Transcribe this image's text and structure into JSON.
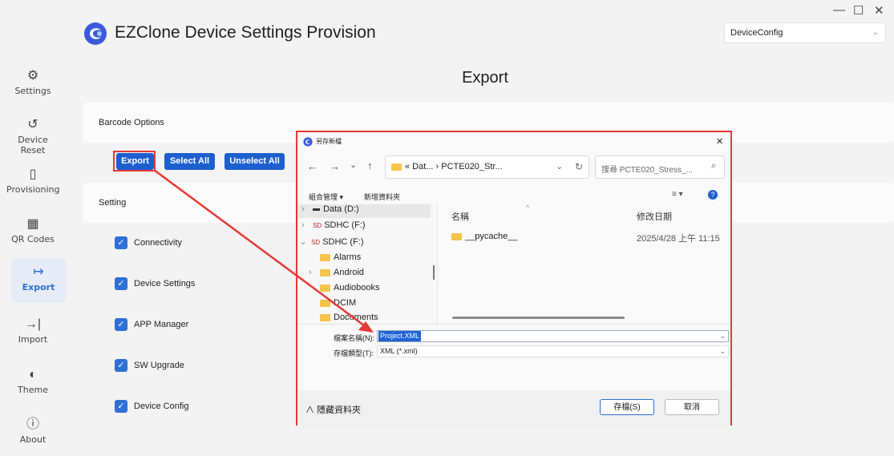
{
  "window": {
    "minimize": "—",
    "maximize": "☐",
    "close": "✕"
  },
  "header": {
    "title": "EZClone Device Settings Provision",
    "config_value": "DeviceConfig",
    "chevron": "⌄"
  },
  "sidebar": {
    "items": [
      {
        "label": "Settings",
        "icon": "⚙",
        "icon_name": "gear-icon"
      },
      {
        "label": "Device Reset",
        "icon": "↺",
        "icon_name": "reset-icon"
      },
      {
        "label": "Provisioning",
        "icon": "▯",
        "icon_name": "provisioning-icon"
      },
      {
        "label": "QR Codes",
        "icon": "▦",
        "icon_name": "qr-code-icon"
      },
      {
        "label": "Export",
        "icon": "↦",
        "icon_name": "export-icon"
      },
      {
        "label": "Import",
        "icon": "→|",
        "icon_name": "import-icon"
      },
      {
        "label": "Theme",
        "icon": "◐",
        "icon_name": "theme-icon"
      },
      {
        "label": "About",
        "icon": "ⓘ",
        "icon_name": "info-icon"
      }
    ],
    "active": "Export",
    "accent": "#2f6fd6"
  },
  "main": {
    "title": "Export",
    "barcode_options_label": "Barcode Options",
    "buttons": {
      "export": "Export",
      "select_all": "Select All",
      "unselect_all": "Unselect All"
    },
    "setting_label": "Setting",
    "checkboxes": [
      {
        "label": "Connectivity",
        "checked": true
      },
      {
        "label": "Device Settings",
        "checked": true
      },
      {
        "label": "APP Manager",
        "checked": true
      },
      {
        "label": "SW Upgrade",
        "checked": true
      },
      {
        "label": "Device Config",
        "checked": true
      }
    ],
    "check_mark": "✓"
  },
  "dialog": {
    "title": "另存新檔",
    "close": "✕",
    "nav": {
      "back": "←",
      "forward": "→",
      "recent": "⌄",
      "up": "↑"
    },
    "address": "« Dat... › PCTE020_Str...",
    "address_chevron": "⌄",
    "refresh": "↻",
    "search_placeholder": "搜尋 PCTE020_Stress_...",
    "search_icon": "⌕",
    "toolbar": {
      "organize": "組合管理 ▾",
      "new_folder": "新增資料夾",
      "view": "≡ ▾",
      "help": "?"
    },
    "tree": [
      {
        "label": "Data (D:)",
        "prefix": "›"
      },
      {
        "label": "SDHC (F:)",
        "prefix": "›"
      },
      {
        "label": "SDHC (F:)",
        "prefix": "⌄"
      },
      {
        "label": "Alarms",
        "prefix": ""
      },
      {
        "label": "Android",
        "prefix": "›"
      },
      {
        "label": "Audiobooks",
        "prefix": ""
      },
      {
        "label": "DCIM",
        "prefix": ""
      },
      {
        "label": "Documents",
        "prefix": ""
      }
    ],
    "columns": {
      "name": "名稱",
      "modified": "修改日期"
    },
    "files": [
      {
        "name": "__pycache__",
        "modified": "2025/4/28 上午 11:15"
      }
    ],
    "filename_label": "檔案名稱(N):",
    "filename_value": "Project.XML",
    "filetype_label": "存檔類型(T):",
    "filetype_value": "XML (*.xml)",
    "hide_folders": "∧ 隱藏資料夾",
    "save": "存檔(S)",
    "cancel": "取消",
    "highlight_color": "#e53935"
  }
}
